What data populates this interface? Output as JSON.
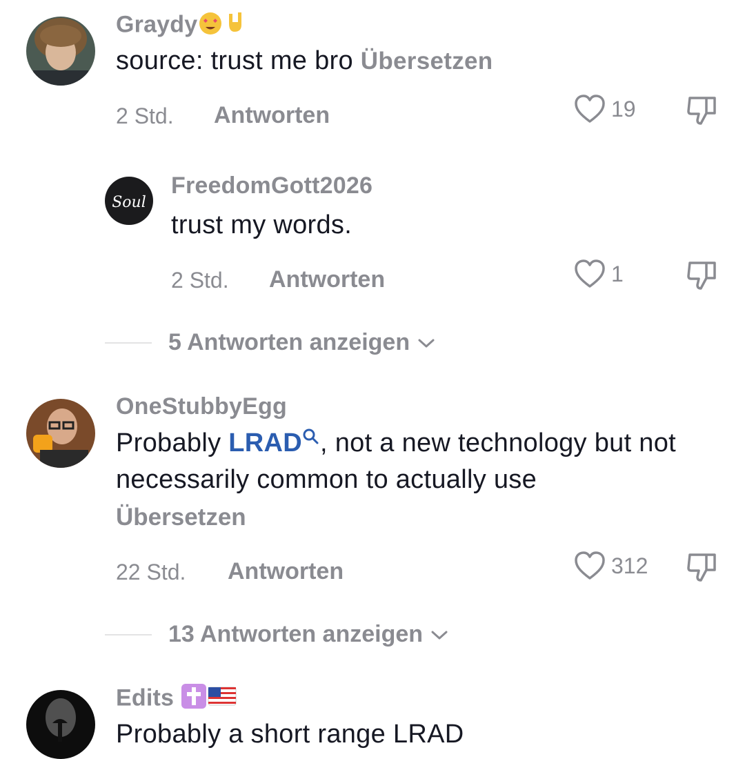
{
  "comments": [
    {
      "username": "Graydy",
      "text": "source: trust me bro",
      "translate_label": "Übersetzen",
      "time": "2 Std.",
      "reply_label": "Antworten",
      "likes": "19"
    },
    {
      "username": "FreedomGott2026",
      "text": "trust my words.",
      "time": "2 Std.",
      "reply_label": "Antworten",
      "likes": "1",
      "avatar_text": "Soul"
    },
    {
      "username": "OneStubbyEgg",
      "text_before": "Probably ",
      "link": "LRAD",
      "text_after": ", not a new technology but not necessarily common to actually use",
      "translate_label": "Übersetzen",
      "time": "22 Std.",
      "reply_label": "Antworten",
      "likes": "312"
    },
    {
      "username": "Edits",
      "text": "Probably a short range LRAD"
    }
  ],
  "view_replies": [
    {
      "label": "5 Antworten anzeigen"
    },
    {
      "label": "13 Antworten anzeigen"
    }
  ],
  "icons": {
    "like": "heart-outline-icon",
    "dislike": "thumbs-down-icon",
    "chevron": "chevron-down-icon",
    "search": "search-icon"
  },
  "colors": {
    "text": "#161823",
    "secondary": "#8a8b91",
    "link": "#2b5db0"
  }
}
